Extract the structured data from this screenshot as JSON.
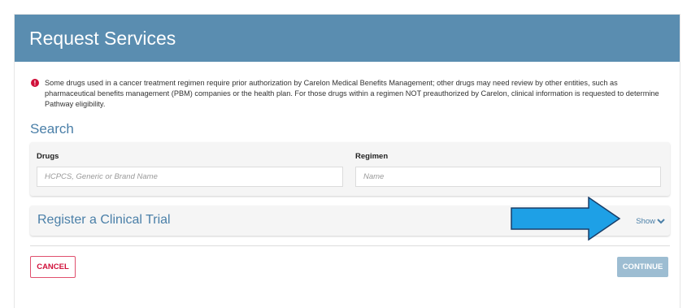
{
  "header": {
    "title": "Request Services"
  },
  "alert": {
    "icon": "exclamation-icon",
    "text": "Some drugs used in a cancer treatment regimen require prior authorization by Carelon Medical Benefits Management; other drugs may need review by other entities, such as pharmaceutical benefits management (PBM) companies or the health plan. For those drugs within a regimen NOT preauthorized by Carelon, clinical information is requested to determine Pathway eligibility."
  },
  "search": {
    "title": "Search",
    "drugs": {
      "label": "Drugs",
      "placeholder": "HCPCS, Generic or Brand Name"
    },
    "regimen": {
      "label": "Regimen",
      "placeholder": "Name"
    }
  },
  "clinical_trial": {
    "title": "Register a Clinical Trial",
    "toggle_label": "Show"
  },
  "actions": {
    "cancel_label": "CANCEL",
    "continue_label": "CONTINUE"
  },
  "colors": {
    "header": "#5a8db0",
    "accent": "#4a7fa8",
    "cancel": "#d0103a",
    "continue": "#9dbdd2",
    "annotation_arrow": "#1ea0e6"
  }
}
